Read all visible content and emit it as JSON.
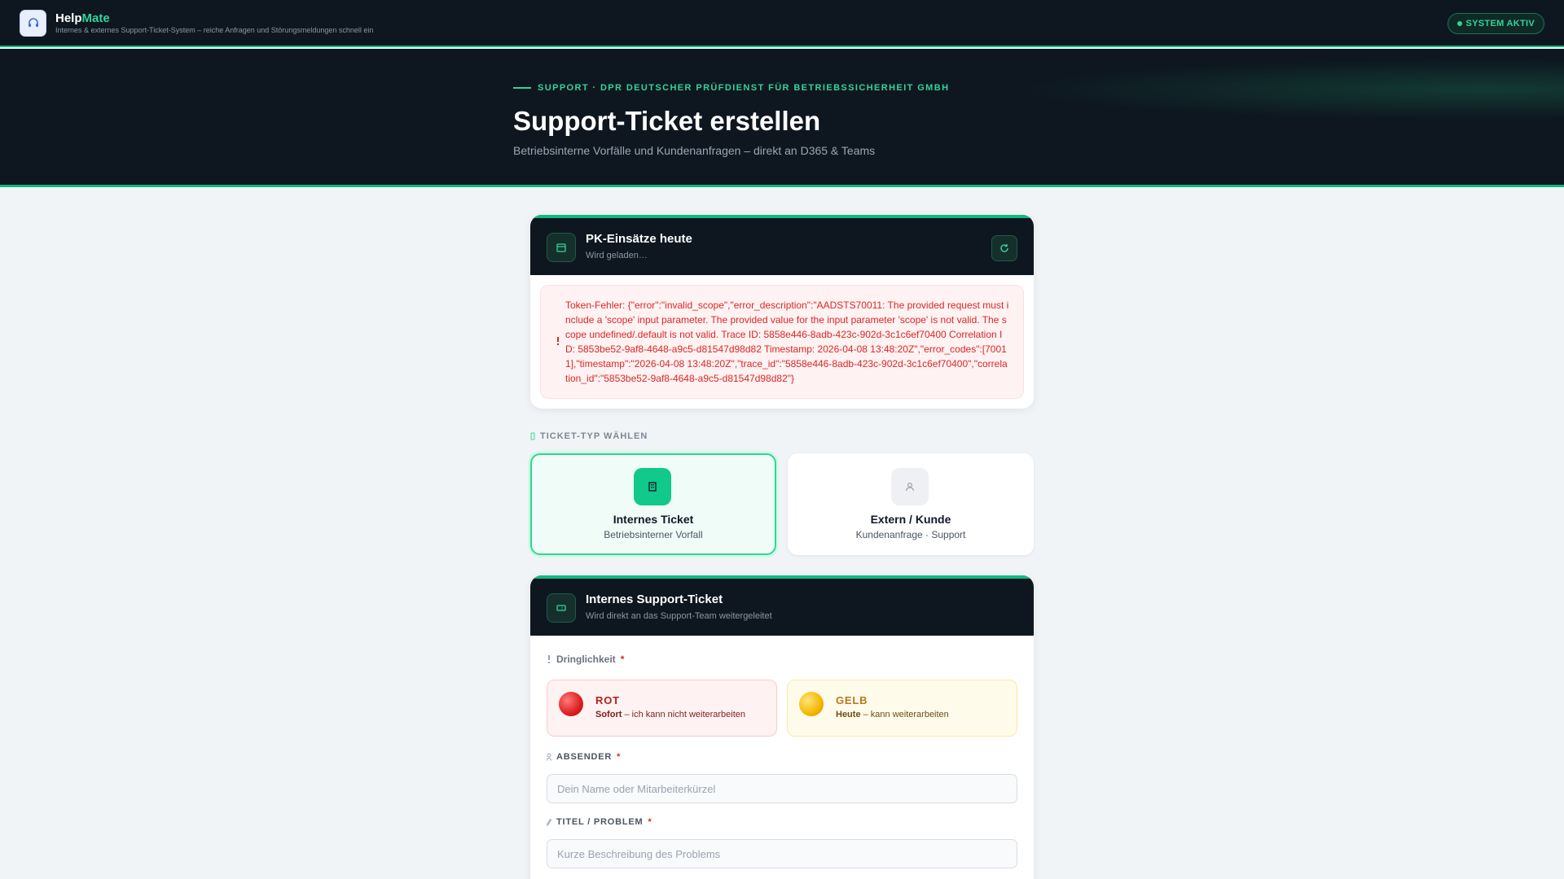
{
  "app": {
    "brand_part1": "Help",
    "brand_part2": "Mate",
    "tagline": "Internes & externes Support-Ticket-System – reiche Anfragen und Störungsmeldungen schnell ein",
    "status": "SYSTEM AKTIV"
  },
  "hero": {
    "eyebrow": "Support · DPR Deutscher Prüfdienst für Betriebssicherheit GmbH",
    "title": "Support-Ticket erstellen",
    "subtitle": "Betriebsinterne Vorfälle und Kundenanfragen – direkt an D365 & Teams"
  },
  "pk_card": {
    "title": "PK-Einsätze heute",
    "subtitle": "Wird geladen…",
    "error": "Token-Fehler: {\"error\":\"invalid_scope\",\"error_description\":\"AADSTS70011: The provided request must include a 'scope' input parameter. The provided value for the input parameter 'scope' is not valid. The scope undefined/.default is not valid. Trace ID: 5858e446-8adb-423c-902d-3c1c6ef70400 Correlation ID: 5853be52-9af8-4648-a9c5-d81547d98d82 Timestamp: 2026-04-08 13:48:20Z\",\"error_codes\":[70011],\"timestamp\":\"2026-04-08 13:48:20Z\",\"trace_id\":\"5858e446-8adb-423c-902d-3c1c6ef70400\",\"correlation_id\":\"5853be52-9af8-4648-a9c5-d81547d98d82\"}"
  },
  "ticket_type": {
    "label": "Ticket-Typ wählen",
    "options": [
      {
        "title": "Internes Ticket",
        "subtitle": "Betriebsinterner Vorfall",
        "selected": true
      },
      {
        "title": "Extern / Kunde",
        "subtitle": "Kundenanfrage · Support",
        "selected": false
      }
    ]
  },
  "form": {
    "title": "Internes Support-Ticket",
    "subtitle": "Wird direkt an das Support-Team weitergeleitet",
    "urgency_label": "Dringlichkeit",
    "urgency_options": [
      {
        "title": "ROT",
        "strong": "Sofort",
        "rest": " – ich kann nicht weiterarbeiten"
      },
      {
        "title": "GELB",
        "strong": "Heute",
        "rest": " – kann weiterarbeiten"
      }
    ],
    "sender_label": "Absender",
    "sender_placeholder": "Dein Name oder Mitarbeiterkürzel",
    "sender_value": "",
    "title_label": "Titel / Problem",
    "title_placeholder": "Kurze Beschreibung des Problems",
    "title_value": ""
  },
  "colors": {
    "accent": "#10b981",
    "dark": "#0e1720",
    "error": "#dc2626"
  }
}
